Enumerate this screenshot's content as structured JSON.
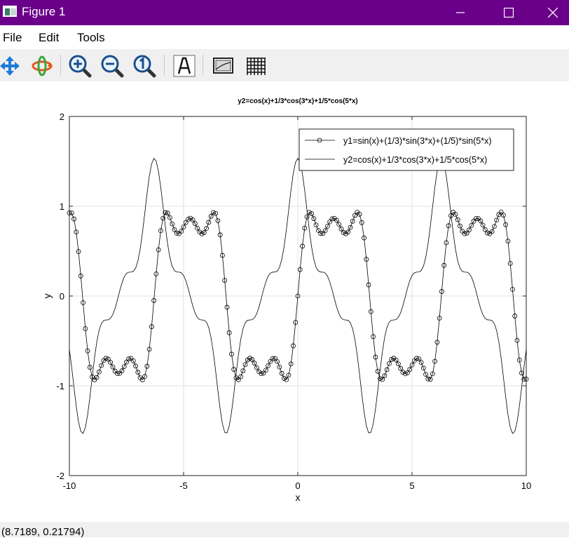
{
  "window": {
    "title": "Figure 1",
    "titlebar_color": "#6a0089",
    "controls": [
      "minimize-icon",
      "maximize-icon",
      "close-icon"
    ]
  },
  "menu": {
    "items": [
      "File",
      "Edit",
      "Tools"
    ]
  },
  "toolbar": {
    "tools": [
      "pan-icon",
      "rotate-icon",
      "zoom-in-icon",
      "zoom-out-icon",
      "zoom-reset-icon",
      "text-annotation-icon",
      "axes-box-icon",
      "grid-icon"
    ]
  },
  "chart_data": {
    "type": "line",
    "title": "y2=cos(x)+1/3*cos(3*x)+1/5*cos(5*x)",
    "xlabel": "x",
    "ylabel": "y",
    "xlim": [
      -10,
      10
    ],
    "ylim": [
      -2,
      2
    ],
    "xticks": [
      -10,
      -5,
      0,
      5,
      10
    ],
    "yticks": [
      -2,
      -1,
      0,
      1,
      2
    ],
    "xtick_labels": [
      "-10",
      "-5",
      "0",
      "5",
      "10"
    ],
    "ytick_labels": [
      "-2",
      "-1",
      "0",
      "1",
      "2"
    ],
    "grid": true,
    "legend_position": "top-right",
    "samples": 201,
    "series": [
      {
        "name": "y1=sin(x)+(1/3)*sin(3*x)+(1/5)*sin(5*x)",
        "formula": "sin(x)+(1/3)*sin(3*x)+(1/5)*sin(5*x)",
        "marker": "circle",
        "color": "#000000"
      },
      {
        "name": "y2=cos(x)+1/3*cos(3*x)+1/5*cos(5*x)",
        "formula": "cos(x)+1/3*cos(3*x)+1/5*cos(5*x)",
        "marker": "none",
        "color": "#000000"
      }
    ]
  },
  "status": {
    "text": "(8.7189, 0.21794)"
  }
}
